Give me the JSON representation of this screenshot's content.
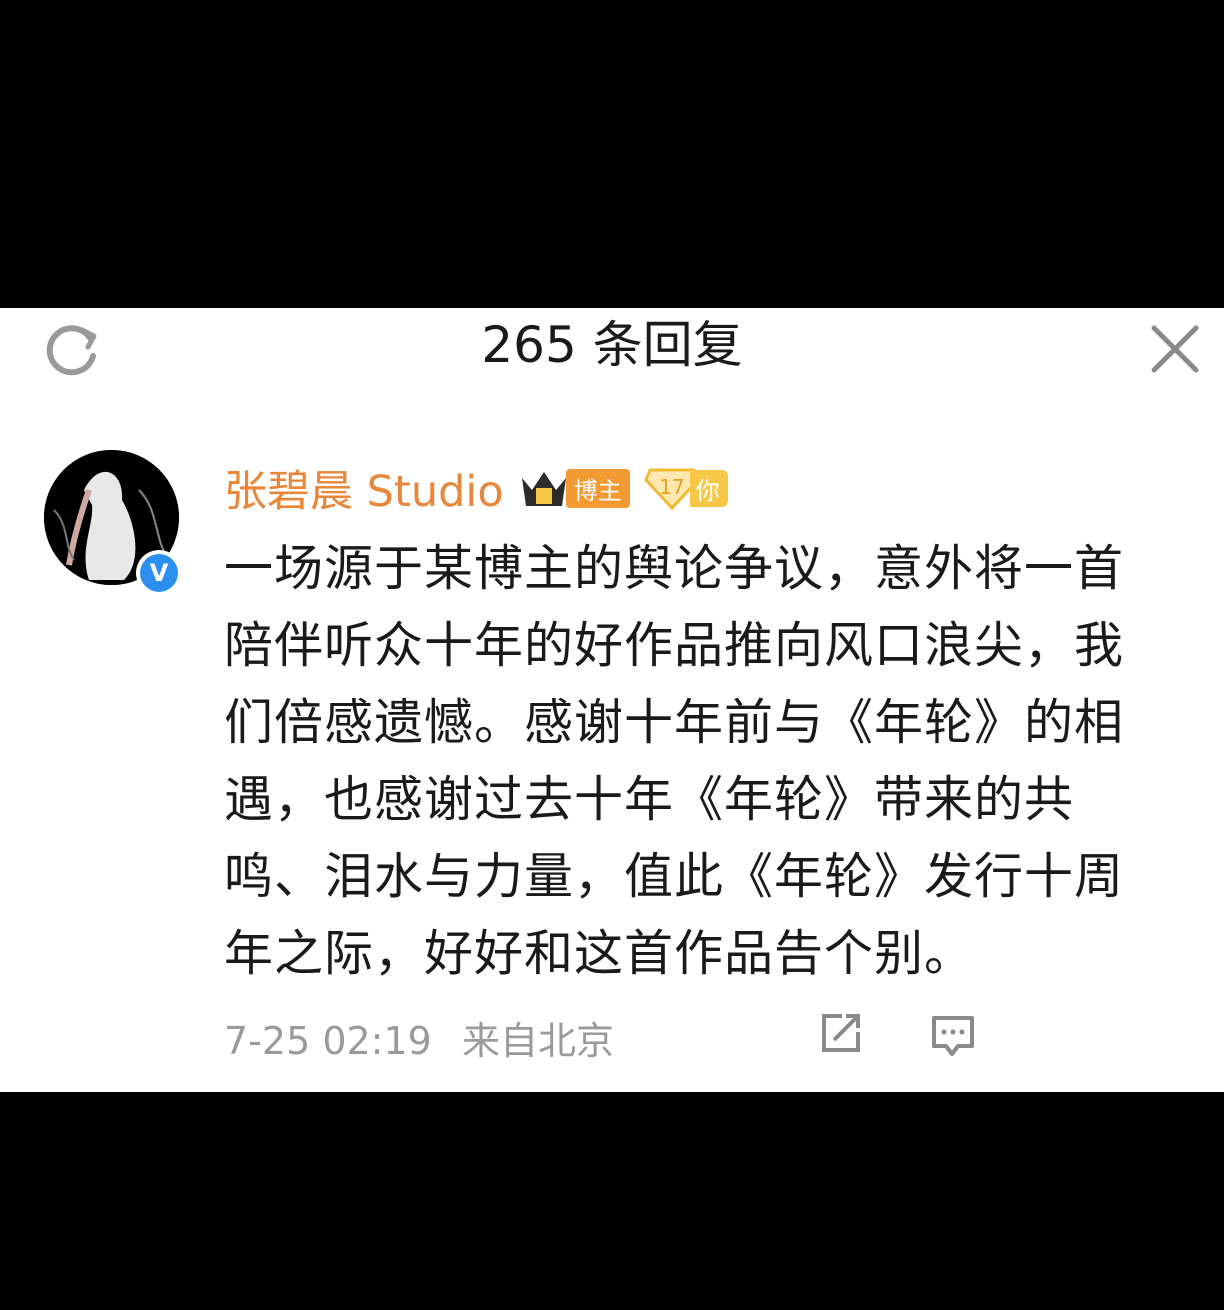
{
  "header": {
    "title": "265 条回复",
    "refresh_icon": "refresh-icon",
    "close_icon": "close-icon"
  },
  "post": {
    "username": "张碧晨 Studio",
    "badges": {
      "crown_icon": "crown-icon",
      "blogger_label": "博主",
      "fan_level": "17",
      "fan_label": "你"
    },
    "verified_icon": "verified-icon",
    "verified_mark": "V",
    "content_lines": [
      "一场源于某博主的舆论争议，意外将一首",
      "陪伴听众十年的好作品推向风口浪尖，我",
      "们倍感遗憾。感谢十年前与《年轮》的相",
      "遇，也感谢过去十年《年轮》带来的共",
      "鸣、泪水与力量，值此《年轮》发行十周",
      "年之际，好好和这首作品告个别。"
    ],
    "date": "7-25 02:19",
    "source": "来自北京",
    "repost_icon": "repost-icon",
    "comment_icon": "comment-icon"
  },
  "colors": {
    "username": "#e8863a",
    "text": "#1a1a1a",
    "meta": "#9a9a9a",
    "verified": "#2c8ff0",
    "blogger_badge": "#f39a33",
    "fan_badge": "#f7c748"
  }
}
